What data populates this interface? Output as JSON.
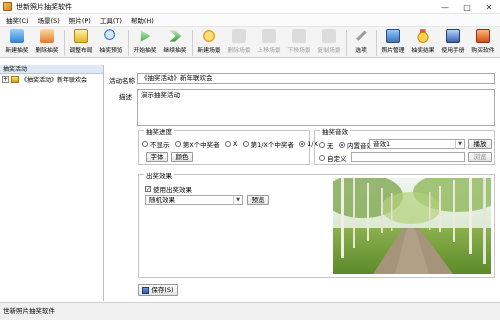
{
  "window": {
    "title": "世新照片抽奖软件"
  },
  "menu": [
    "抽奖(C)",
    "场景(S)",
    "照片(P)",
    "工具(T)",
    "帮助(H)"
  ],
  "toolbar": [
    {
      "label": "新建抽奖",
      "icon": "new-event-icon",
      "cls": "ico-newevt",
      "disabled": false
    },
    {
      "label": "删除抽奖",
      "icon": "delete-event-icon",
      "cls": "ico-delevt",
      "disabled": false
    },
    {
      "label": "调整布局",
      "icon": "layout-icon",
      "cls": "ico-layout",
      "disabled": false
    },
    {
      "label": "抽奖预览",
      "icon": "preview-icon",
      "cls": "ico-preview",
      "disabled": false
    },
    {
      "label": "开始抽奖",
      "icon": "start-icon",
      "cls": "ico-start",
      "disabled": false
    },
    {
      "label": "继续抽奖",
      "icon": "continue-icon",
      "cls": "ico-continue",
      "disabled": false
    },
    {
      "label": "新建场景",
      "icon": "new-scene-icon",
      "cls": "ico-newscene",
      "disabled": false
    },
    {
      "label": "删除场景",
      "icon": "delete-scene-icon",
      "cls": "ico-gray",
      "disabled": true
    },
    {
      "label": "上移场景",
      "icon": "move-up-icon",
      "cls": "ico-gray",
      "disabled": true
    },
    {
      "label": "下移场景",
      "icon": "move-down-icon",
      "cls": "ico-gray",
      "disabled": true
    },
    {
      "label": "复制场景",
      "icon": "copy-scene-icon",
      "cls": "ico-gray",
      "disabled": true
    },
    {
      "label": "选项",
      "icon": "options-icon",
      "cls": "ico-options",
      "disabled": false
    },
    {
      "label": "照片管理",
      "icon": "photo-manage-icon",
      "cls": "ico-photo",
      "disabled": false
    },
    {
      "label": "抽奖结果",
      "icon": "result-icon",
      "cls": "ico-result",
      "disabled": false
    },
    {
      "label": "使用手册",
      "icon": "manual-icon",
      "cls": "ico-manual",
      "disabled": false
    },
    {
      "label": "购买软件",
      "icon": "buy-icon",
      "cls": "ico-buy",
      "disabled": false
    }
  ],
  "left_panel": {
    "header": "抽奖活动",
    "tree": [
      {
        "expander": "+",
        "label": "《抽奖活动》新年联欢会"
      }
    ]
  },
  "form": {
    "name_label": "活动名称",
    "name_value": "《抽奖活动》新年联欢会",
    "desc_label": "描述",
    "desc_value": "演示抽奖活动",
    "progress_group": {
      "title": "抽奖进度",
      "options": [
        "不显示",
        "第X个中奖者",
        "X",
        "第1/X个中奖者",
        "1/X"
      ],
      "selected": 4,
      "font_button": "字体",
      "color_button": "颜色"
    },
    "sound_group": {
      "title": "抽奖音效",
      "opt_none": "无",
      "opt_builtin": "内置音效",
      "builtin_value": "音效1",
      "play_button": "播放",
      "opt_custom": "自定义",
      "browse_button": "浏览",
      "selected": "builtin"
    },
    "effect_group": {
      "title": "出奖效果",
      "use_effect_label": "使用出奖效果",
      "use_effect_checked": "✓",
      "effect_value": "随机效果",
      "preview_button": "预览"
    },
    "save_button": "保存(S)"
  },
  "status": {
    "text": "世新照片抽奖软件"
  }
}
